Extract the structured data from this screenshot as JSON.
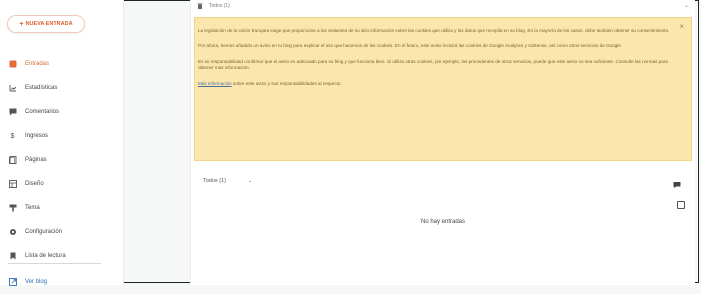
{
  "sidebar": {
    "new_post_label": "NUEVA ENTRADA",
    "items": [
      {
        "label": "Entradas",
        "icon": "posts-icon",
        "state": "active"
      },
      {
        "label": "Estadísticas",
        "icon": "stats-icon"
      },
      {
        "label": "Comentarios",
        "icon": "comments-icon"
      },
      {
        "label": "Ingresos",
        "icon": "dollar-icon"
      },
      {
        "label": "Páginas",
        "icon": "pages-icon"
      },
      {
        "label": "Diseño",
        "icon": "layout-icon"
      },
      {
        "label": "Tema",
        "icon": "paint-icon"
      },
      {
        "label": "Configuración",
        "icon": "gear-icon"
      },
      {
        "label": "Lista de lectura",
        "icon": "bookmark-icon"
      },
      {
        "label": "Ver blog",
        "icon": "external-icon",
        "state": "current"
      }
    ]
  },
  "main": {
    "topbar_title": "Todos (1)",
    "notice": {
      "p1": "La legislación de la Unión Europea exige que proporcione a los visitantes de su sitio información sobre las cookies que utiliza y los datos que recopila en su blog. En la mayoría de los casos, debe también obtener su consentimiento.",
      "p2": "Por ahora, hemos añadido un aviso en tu blog para explicar el uso que hacemos de las cookies. En el futuro, este aviso incluirá las cookies de Google Analytics y AdSense, así como otros servicios de Google.",
      "p3": "Es su responsabilidad confirmar que el aviso es adecuado para su blog y que funciona bien. Si utiliza otras cookies, por ejemplo, las procedentes de otros servicios, puede que este aviso no sea suficiente. Consulte las normas para obtener más información.",
      "p4_link": "Más información",
      "p4_rest": " sobre este aviso y sus responsabilidades al respecto.",
      "close_label": "×"
    },
    "filter_label": "Todos (1)",
    "empty_text": "No hay entradas"
  },
  "colors": {
    "accent": "#e26b3a",
    "notice_bg": "#fbe7ae",
    "link": "#2e6fb5"
  }
}
